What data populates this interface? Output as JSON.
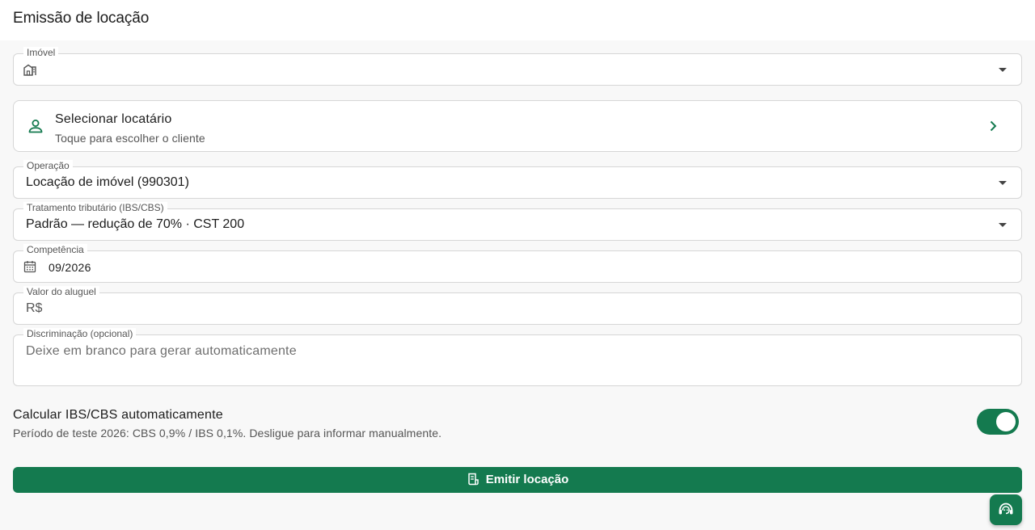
{
  "header": {
    "title": "Emissão de locação"
  },
  "property_field": {
    "label": "Imóvel",
    "value": ""
  },
  "tenant_picker": {
    "title": "Selecionar locatário",
    "subtitle": "Toque para escolher o cliente"
  },
  "operation_field": {
    "label": "Operação",
    "value": "Locação de imóvel (990301)"
  },
  "tax_field": {
    "label": "Tratamento tributário (IBS/CBS)",
    "value": "Padrão — redução de 70% · CST 200"
  },
  "period_field": {
    "label": "Competência",
    "value": "09/2026"
  },
  "rent_field": {
    "label": "Valor do aluguel",
    "prefix": "R$",
    "value": ""
  },
  "description_field": {
    "label": "Discriminação (opcional)",
    "placeholder": "Deixe em branco para gerar automaticamente"
  },
  "auto_tax_toggle": {
    "title": "Calcular IBS/CBS automaticamente",
    "subtitle": "Período de teste 2026: CBS 0,9% / IBS 0,1%. Desligue para informar manualmente.",
    "on": true
  },
  "submit_button": {
    "label": "Emitir locação",
    "icon": "receipt-icon"
  },
  "support_fab": {
    "icon": "support-agent-icon"
  },
  "colors": {
    "accent": "#147a4f",
    "background": "#f8f8f8",
    "surface": "#ffffff",
    "border": "#d6d6d6"
  }
}
